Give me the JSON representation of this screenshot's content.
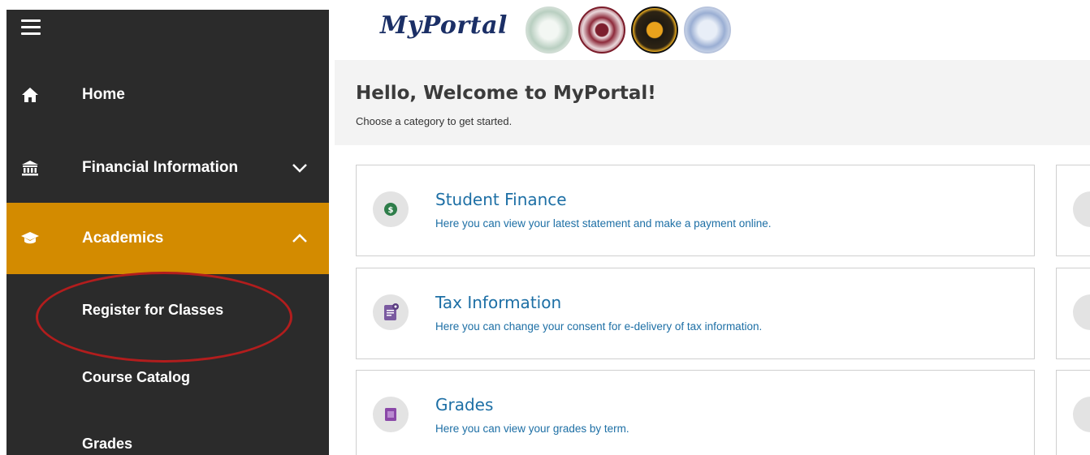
{
  "header": {
    "logo_text": "MyPortal"
  },
  "sidebar": {
    "items": [
      {
        "label": "Home",
        "icon": "home-icon"
      },
      {
        "label": "Financial Information",
        "icon": "bank-icon",
        "chevron": "chevron-down-icon"
      },
      {
        "label": "Academics",
        "icon": "graduation-cap-icon",
        "chevron": "chevron-up-icon",
        "active": true
      }
    ],
    "subitems": [
      {
        "label": "Register for Classes"
      },
      {
        "label": "Course Catalog"
      },
      {
        "label": "Grades"
      }
    ],
    "active_color": "#d38b00"
  },
  "main": {
    "welcome": "Hello, Welcome to MyPortal!",
    "subtitle": "Choose a category to get started.",
    "cards": [
      {
        "title": "Student Finance",
        "description": "Here you can view your latest statement and make a payment online.",
        "icon": "dollar-icon"
      },
      {
        "title": "Tax Information",
        "description": "Here you can change your consent for e-delivery of tax information.",
        "icon": "document-icon"
      },
      {
        "title": "Grades",
        "description": "Here you can view your grades by term.",
        "icon": "grades-icon"
      }
    ],
    "link_color": "#1d6fa5"
  },
  "annotation": {
    "color": "#b21d1d"
  }
}
